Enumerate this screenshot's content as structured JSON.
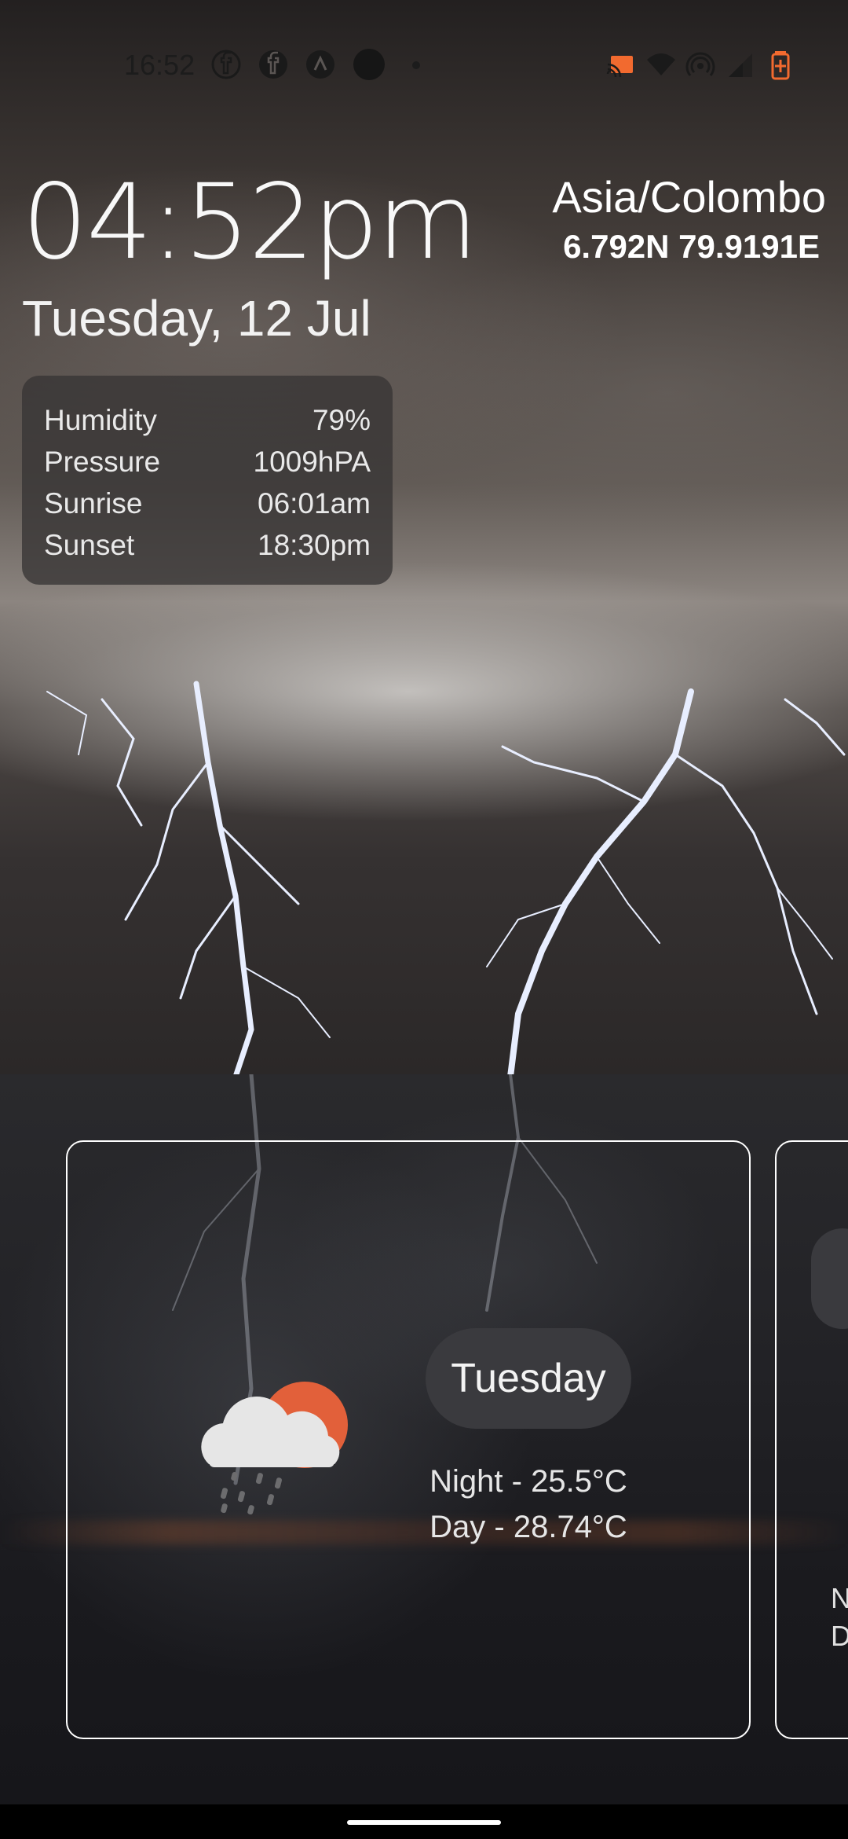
{
  "status_bar": {
    "time": "16:52",
    "icons": [
      "facebook-icon",
      "facebook-icon",
      "app-icon",
      "app-circle-icon",
      "dot-icon",
      "cast-icon",
      "wifi-icon",
      "hotspot-icon",
      "signal-icon",
      "battery-charging-icon"
    ],
    "accent_color": "#f26a2f"
  },
  "clock": {
    "time": "04:52pm",
    "date": "Tuesday, 12 Jul"
  },
  "location": {
    "timezone": "Asia/Colombo",
    "coordinates": "6.792N 79.9191E"
  },
  "details": [
    {
      "label": "Humidity",
      "value": "79%"
    },
    {
      "label": "Pressure",
      "value": "1009hPA"
    },
    {
      "label": "Sunrise",
      "value": "06:01am"
    },
    {
      "label": "Sunset",
      "value": "18:30pm"
    }
  ],
  "forecast": [
    {
      "day": "Tuesday",
      "icon": "cloud-sun-rain-icon",
      "night": "Night - 25.5°C",
      "day_temp": "Day - 28.74°C"
    }
  ],
  "forecast_peek": {
    "night_fragment": "N",
    "day_fragment": "D"
  }
}
